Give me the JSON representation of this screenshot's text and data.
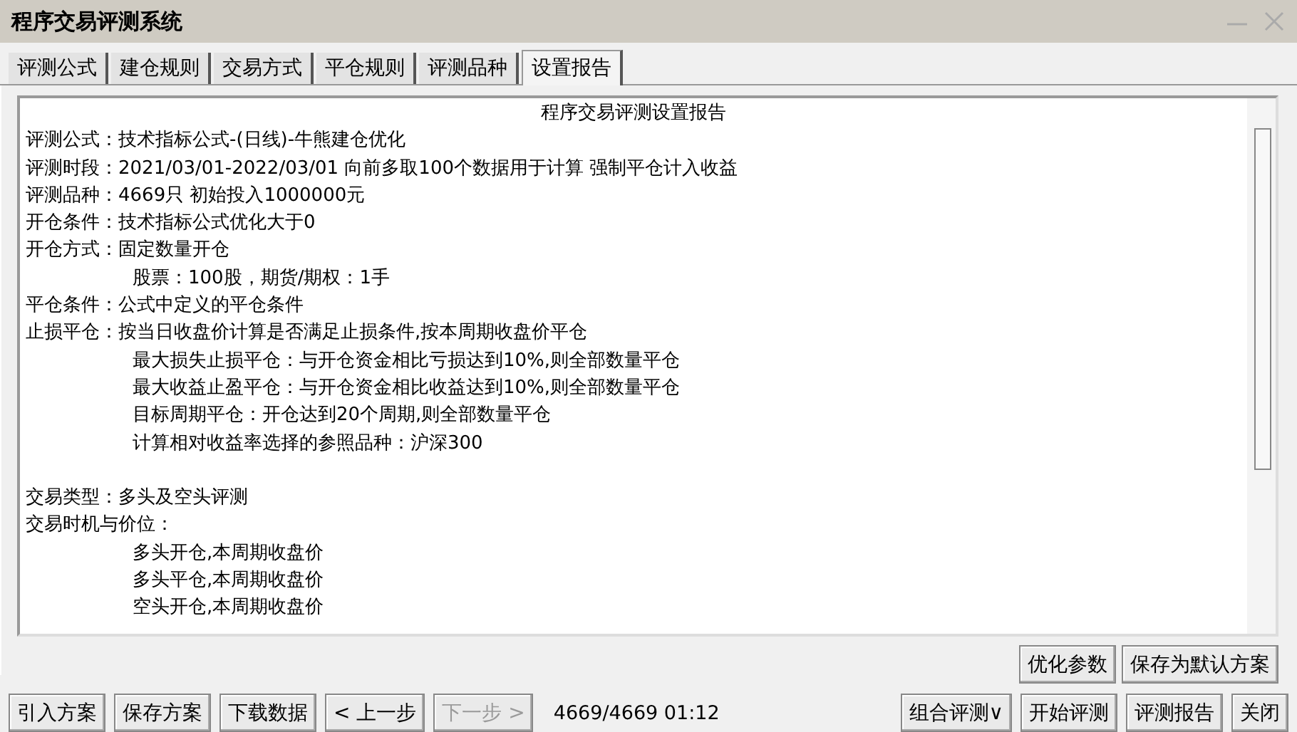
{
  "window": {
    "title": "程序交易评测系统"
  },
  "tabs": [
    {
      "label": "评测公式",
      "selected": false
    },
    {
      "label": "建仓规则",
      "selected": false
    },
    {
      "label": "交易方式",
      "selected": false
    },
    {
      "label": "平仓规则",
      "selected": false
    },
    {
      "label": "评测品种",
      "selected": false
    },
    {
      "label": "设置报告",
      "selected": true
    }
  ],
  "report": {
    "lines": [
      {
        "kind": "title",
        "text": "程序交易评测设置报告"
      },
      {
        "kind": "line",
        "text": "评测公式：技术指标公式-(日线)-牛熊建仓优化"
      },
      {
        "kind": "line",
        "text": "评测时段：2021/03/01-2022/03/01 向前多取100个数据用于计算 强制平仓计入收益"
      },
      {
        "kind": "line",
        "text": "评测品种：4669只 初始投入1000000元"
      },
      {
        "kind": "line",
        "text": "开仓条件：技术指标公式优化大于0"
      },
      {
        "kind": "line",
        "text": "开仓方式：固定数量开仓"
      },
      {
        "kind": "indent",
        "text": "股票：100股，期货/期权：1手"
      },
      {
        "kind": "line",
        "text": "平仓条件：公式中定义的平仓条件"
      },
      {
        "kind": "line",
        "text": "止损平仓：按当日收盘价计算是否满足止损条件,按本周期收盘价平仓"
      },
      {
        "kind": "indent",
        "text": "最大损失止损平仓：与开仓资金相比亏损达到10%,则全部数量平仓"
      },
      {
        "kind": "indent",
        "text": "最大收益止盈平仓：与开仓资金相比收益达到10%,则全部数量平仓"
      },
      {
        "kind": "indent",
        "text": "目标周期平仓：开仓达到20个周期,则全部数量平仓"
      },
      {
        "kind": "indent",
        "text": "计算相对收益率选择的参照品种：沪深300"
      },
      {
        "kind": "blank"
      },
      {
        "kind": "line",
        "text": "交易类型：多头及空头评测"
      },
      {
        "kind": "line",
        "text": "交易时机与价位："
      },
      {
        "kind": "indent",
        "text": "多头开仓,本周期收盘价"
      },
      {
        "kind": "indent",
        "text": "多头平仓,本周期收盘价"
      },
      {
        "kind": "indent",
        "text": "空头开仓,本周期收盘价"
      }
    ]
  },
  "panel_buttons": [
    {
      "label": "优化参数"
    },
    {
      "label": "保存为默认方案"
    }
  ],
  "bottom_bar": [
    {
      "kind": "button",
      "label": "引入方案",
      "disabled": false
    },
    {
      "kind": "button",
      "label": "保存方案",
      "disabled": false
    },
    {
      "kind": "button",
      "label": "下载数据",
      "disabled": false
    },
    {
      "kind": "button",
      "label": "< 上一步",
      "disabled": false
    },
    {
      "kind": "button",
      "label": "下一步 >",
      "disabled": true
    },
    {
      "kind": "status",
      "label": "4669/4669 01:12"
    },
    {
      "kind": "dropdown",
      "label": "组合评测∨",
      "disabled": false
    },
    {
      "kind": "button",
      "label": "开始评测",
      "disabled": false
    },
    {
      "kind": "button",
      "label": "评测报告",
      "disabled": false
    },
    {
      "kind": "button",
      "label": "关闭",
      "disabled": false
    }
  ]
}
